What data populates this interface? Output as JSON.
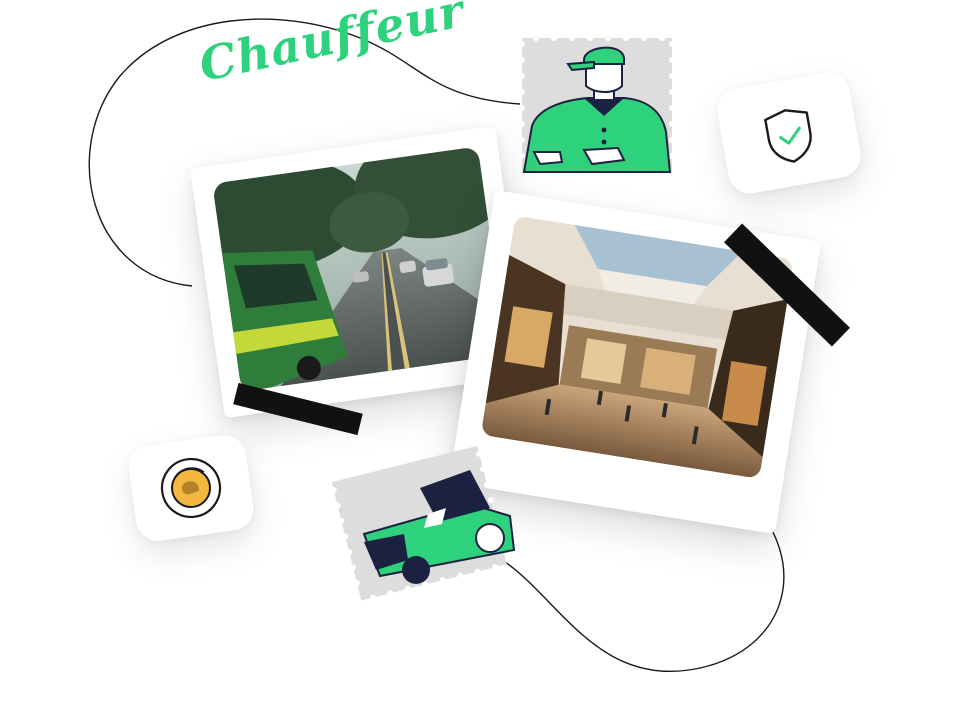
{
  "heading": {
    "script_text": "Chauffeur"
  },
  "colors": {
    "brand_green": "#2fd27c",
    "navy": "#1b2140",
    "stamp_gray": "#dddddd",
    "tape_black": "#111111",
    "coin_gold": "#f3b83f",
    "line_ink": "#1a1a1a"
  },
  "icons": {
    "shield": "shield-check-icon",
    "coin": "coin-icon",
    "driver": "chauffeur-illustration",
    "car": "car-illustration"
  },
  "photos": {
    "street": "street-photo",
    "mall": "mall-photo"
  }
}
